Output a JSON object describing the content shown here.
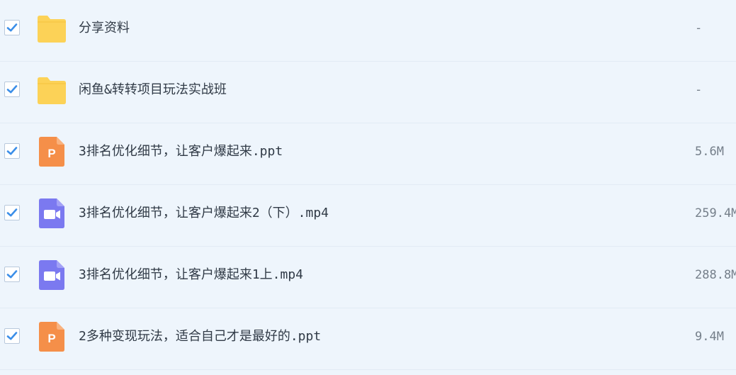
{
  "colors": {
    "background": "#eef5fc",
    "check_mark": "#3b8ee8",
    "folder": "#fcd257",
    "ppt": "#f58f49",
    "video": "#7b79f0"
  },
  "files": [
    {
      "name": "分享资料",
      "size": "-",
      "icon": "folder-icon",
      "checked": true
    },
    {
      "name": "闲鱼&转转项目玩法实战班",
      "size": "-",
      "icon": "folder-icon",
      "checked": true
    },
    {
      "name": "3排名优化细节，让客户爆起来.ppt",
      "size": "5.6M",
      "icon": "ppt-file-icon",
      "icon_letter": "P",
      "checked": true
    },
    {
      "name": "3排名优化细节，让客户爆起来2（下）.mp4",
      "size": "259.4M",
      "icon": "video-file-icon",
      "checked": true
    },
    {
      "name": "3排名优化细节，让客户爆起来1上.mp4",
      "size": "288.8M",
      "icon": "video-file-icon",
      "checked": true
    },
    {
      "name": "2多种变现玩法，适合自己才是最好的.ppt",
      "size": "9.4M",
      "icon": "ppt-file-icon",
      "icon_letter": "P",
      "checked": true
    }
  ]
}
